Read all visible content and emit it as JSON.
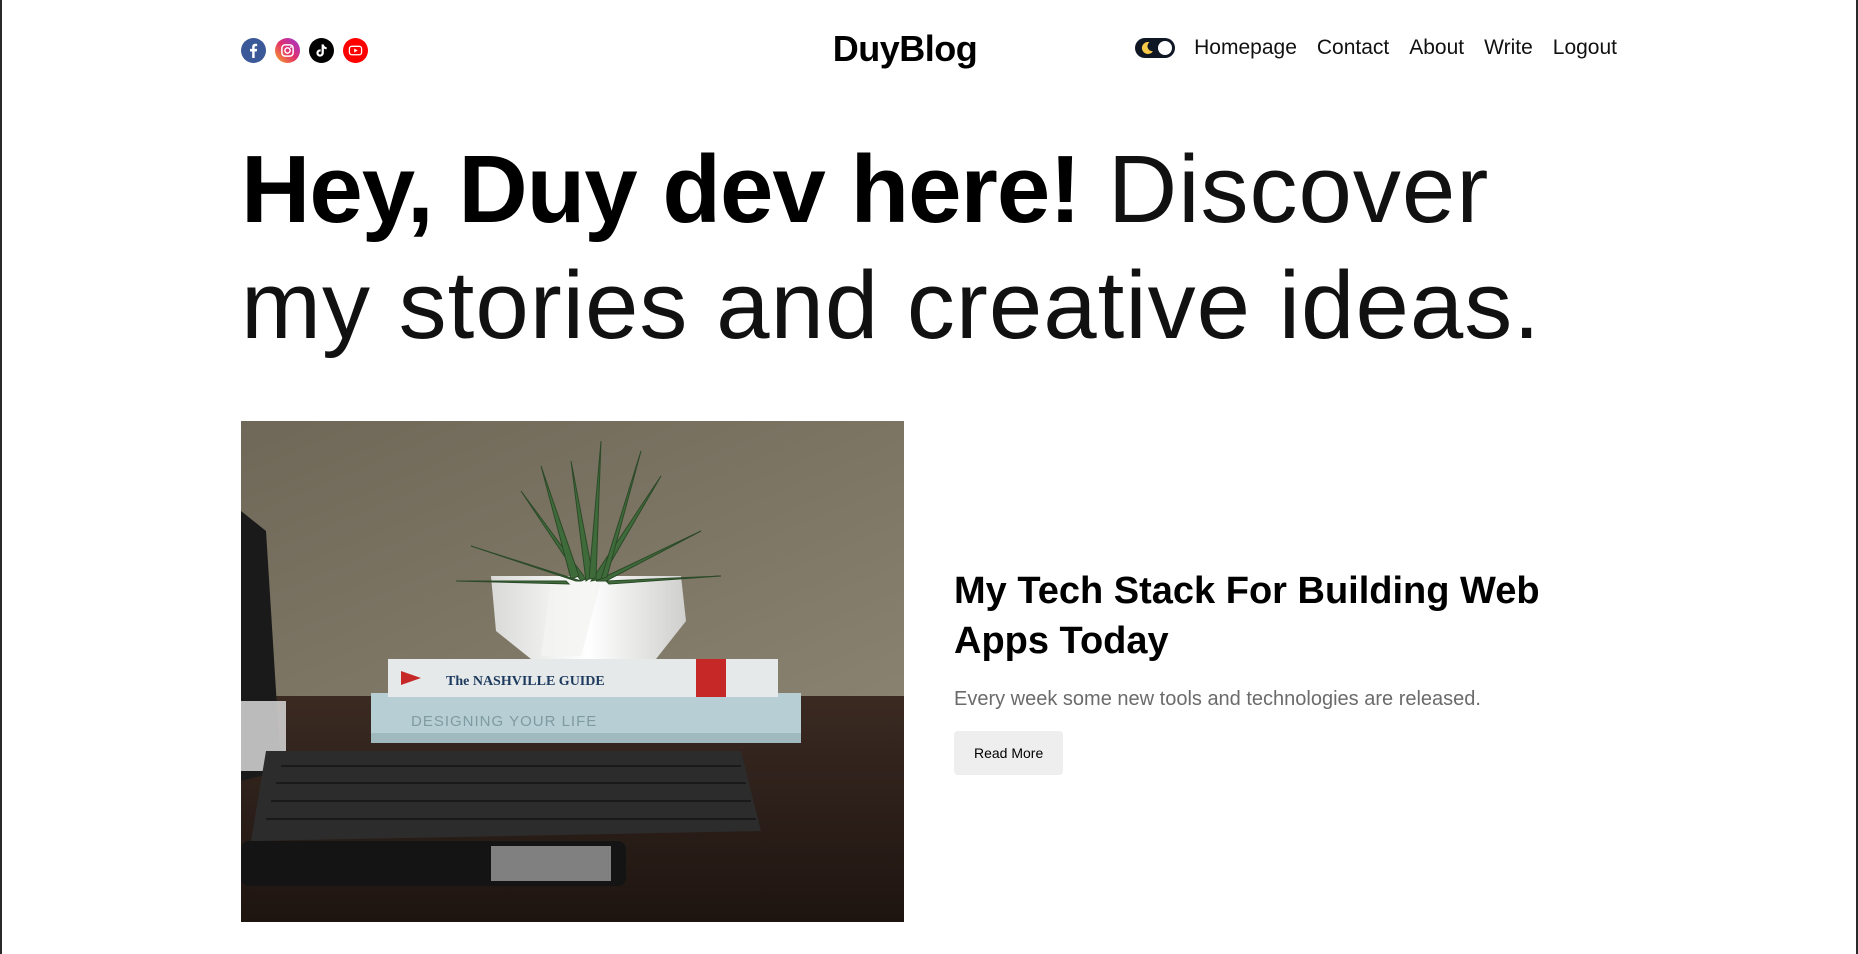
{
  "brand": {
    "logo": "DuyBlog"
  },
  "socials": [
    {
      "name": "facebook",
      "icon": "facebook-icon",
      "color": "#3b5998"
    },
    {
      "name": "instagram",
      "icon": "instagram-icon",
      "color": "#e1306c"
    },
    {
      "name": "tiktok",
      "icon": "tiktok-icon",
      "color": "#000000"
    },
    {
      "name": "youtube",
      "icon": "youtube-icon",
      "color": "#ff0000"
    }
  ],
  "theme_toggle": {
    "icon": "moon-icon",
    "state": "dark",
    "color": "#0f1724"
  },
  "nav": {
    "links": [
      "Homepage",
      "Contact",
      "About",
      "Write",
      "Logout"
    ]
  },
  "hero": {
    "bold": "Hey, Duy dev here!",
    "light": " Discover my stories and creative ideas."
  },
  "featured": {
    "title": "My Tech Stack For Building Web Apps Today",
    "description": "Every week some new tools and technologies are released.",
    "button": "Read More",
    "image_text": {
      "book_top": "The NASHVILLE GUIDE",
      "book_bottom": "DESIGNING YOUR LIFE"
    }
  }
}
